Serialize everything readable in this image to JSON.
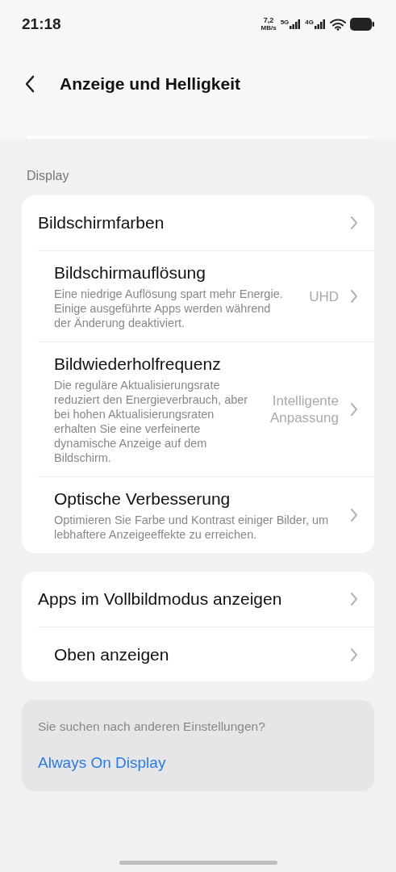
{
  "status_bar": {
    "time": "21:18",
    "speed_value": "7,2",
    "speed_unit": "MB/s",
    "networks": [
      "5G",
      "4G"
    ]
  },
  "header": {
    "title": "Anzeige und Helligkeit"
  },
  "sections": [
    {
      "title": "Display",
      "items": [
        {
          "title": "Bildschirmfarben"
        },
        {
          "title": "Bildschirmauflösung",
          "description": "Eine niedrige Auflösung spart mehr Energie. Einige ausgeführte Apps werden während der Änderung deaktiviert.",
          "value": "UHD"
        },
        {
          "title": "Bildwiederholfrequenz",
          "description": "Die reguläre Aktualisierungsrate reduziert den Energieverbrauch, aber bei hohen Aktualisierungsraten erhalten Sie eine verfeinerte dynamische Anzeige auf dem Bildschirm.",
          "value": "Intelligente Anpassung"
        },
        {
          "title": "Optische Verbesserung",
          "description": "Optimieren Sie Farbe und Kontrast einiger Bilder, um lebhaftere Anzeigeeffekte zu erreichen."
        }
      ]
    },
    {
      "items": [
        {
          "title": "Apps im Vollbildmodus anzeigen"
        },
        {
          "title": "Oben anzeigen"
        }
      ]
    }
  ],
  "suggestion": {
    "question": "Sie suchen nach anderen Einstellungen?",
    "link": "Always On Display"
  }
}
